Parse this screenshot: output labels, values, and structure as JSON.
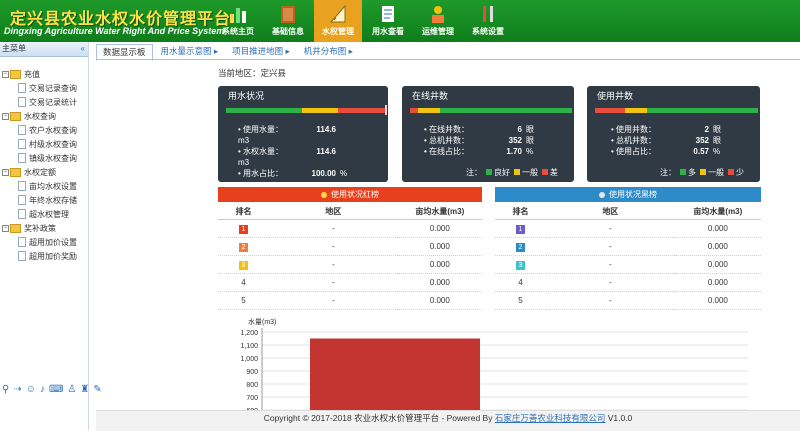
{
  "header": {
    "title": "定兴县农业水权水价管理平台",
    "subtitle": "Dingxing Agriculture Water Right And Price System",
    "nav": [
      {
        "label": "系统主页",
        "icon": "bar-chart-icon"
      },
      {
        "label": "基础信息",
        "icon": "book-icon"
      },
      {
        "label": "水权管理",
        "icon": "ruler-icon",
        "active": true
      },
      {
        "label": "用水查看",
        "icon": "document-icon"
      },
      {
        "label": "运维管理",
        "icon": "worker-icon"
      },
      {
        "label": "系统设置",
        "icon": "tools-icon"
      }
    ]
  },
  "sidebar": {
    "title": "主菜单",
    "collapse": "«",
    "groups": [
      {
        "label": "充值",
        "items": [
          "交易记录查询",
          "交易记录统计"
        ]
      },
      {
        "label": "水权查询",
        "items": [
          "农户水权查询",
          "村级水权查询",
          "镇级水权查询"
        ]
      },
      {
        "label": "水权定额",
        "items": [
          "亩均水权设置",
          "年终水权存储",
          "超水权管理"
        ]
      },
      {
        "label": "奖补政策",
        "items": [
          "超用加价设置",
          "超用加价奖励"
        ]
      }
    ]
  },
  "tabs": [
    "数据显示板",
    "用水量示意图 ▸",
    "项目推进地图 ▸",
    "机井分布图 ▸"
  ],
  "area": "当前地区：定兴县",
  "panels": [
    {
      "title": "用水状况",
      "rows": [
        {
          "label": "使用水量：",
          "value": "114.6",
          "unit": "",
          "second": "m3"
        },
        {
          "label": "水权水量：",
          "value": "114.6",
          "unit": "",
          "second": "m3"
        },
        {
          "label": "用水占比：",
          "value": "100.00",
          "unit": "%"
        }
      ]
    },
    {
      "title": "在线井数",
      "rows": [
        {
          "label": "在线井数：",
          "value": "6",
          "unit": "眼"
        },
        {
          "label": "总机井数：",
          "value": "352",
          "unit": "眼"
        },
        {
          "label": "在线占比：",
          "value": "1.70",
          "unit": "%"
        }
      ],
      "legend_prefix": "注：",
      "legend": [
        {
          "label": "良好",
          "color": "#2db24a"
        },
        {
          "label": "一般",
          "color": "#f1c40f"
        },
        {
          "label": "差",
          "color": "#e74c3c"
        }
      ]
    },
    {
      "title": "使用井数",
      "rows": [
        {
          "label": "使用井数：",
          "value": "2",
          "unit": "眼"
        },
        {
          "label": "总机井数：",
          "value": "352",
          "unit": "眼"
        },
        {
          "label": "使用占比：",
          "value": "0.57",
          "unit": "%"
        }
      ],
      "legend_prefix": "注：",
      "legend": [
        {
          "label": "多",
          "color": "#2db24a"
        },
        {
          "label": "一般",
          "color": "#f1c40f"
        },
        {
          "label": "少",
          "color": "#e74c3c"
        }
      ]
    }
  ],
  "red_board": {
    "title": "使用状况红榜",
    "color": "#e8401c",
    "headers": [
      "排名",
      "地区",
      "亩均水量(m3)"
    ],
    "rows": [
      {
        "rank": "1",
        "area": "-",
        "value": "0.000"
      },
      {
        "rank": "2",
        "area": "-",
        "value": "0.000"
      },
      {
        "rank": "3",
        "area": "-",
        "value": "0.000"
      },
      {
        "rank": "4",
        "area": "-",
        "value": "0.000"
      },
      {
        "rank": "5",
        "area": "-",
        "value": "0.000"
      }
    ],
    "badge_colors": [
      "#e8401c",
      "#f07d3a",
      "#f4c20d"
    ]
  },
  "black_board": {
    "title": "使用状况黑榜",
    "color": "#2d8bc9",
    "headers": [
      "排名",
      "地区",
      "亩均水量(m3)"
    ],
    "rows": [
      {
        "rank": "1",
        "area": "-",
        "value": "0.000"
      },
      {
        "rank": "2",
        "area": "-",
        "value": "0.000"
      },
      {
        "rank": "3",
        "area": "-",
        "value": "0.000"
      },
      {
        "rank": "4",
        "area": "-",
        "value": "0.000"
      },
      {
        "rank": "5",
        "area": "-",
        "value": "0.000"
      }
    ],
    "badge_colors": [
      "#6a5acd",
      "#2d8bc9",
      "#3ec1c9"
    ]
  },
  "chart_data": {
    "type": "bar",
    "ylabel": "水量(m3)",
    "ylim": [
      600,
      1200
    ],
    "yticks": [
      600,
      700,
      800,
      900,
      1000,
      1100,
      1200
    ],
    "series": [
      {
        "values": [
          1150
        ]
      }
    ],
    "bar_color": "#c23531"
  },
  "footer": {
    "text": "Copyright © 2017-2018 农业水权水价管理平台 - Powered By ",
    "company": "石家庄万善农业科技有限公司",
    "version": " V1.0.0"
  }
}
